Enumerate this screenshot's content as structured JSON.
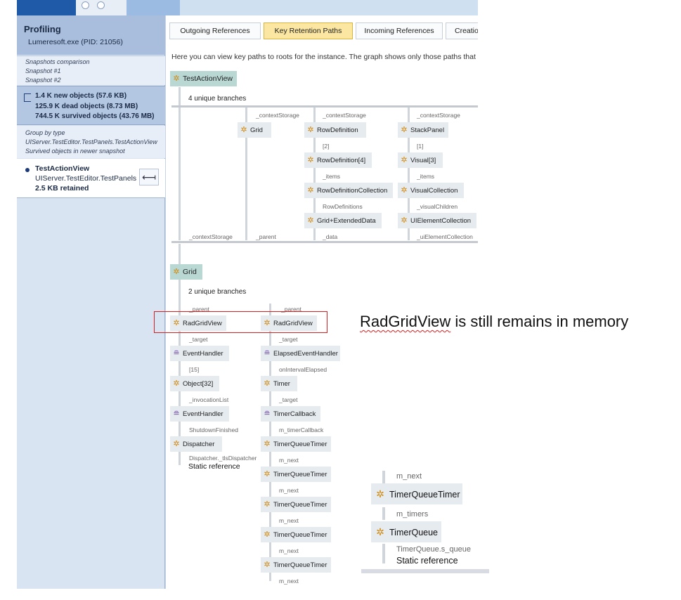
{
  "profiling": {
    "title": "Profiling",
    "process": "Lumeresoft.exe (PID: 21056)",
    "comparison": [
      "Snapshots comparison",
      "Snapshot #1",
      "Snapshot #2"
    ],
    "stats": {
      "new_objects": "1.4 K new objects (57.6 KB)",
      "dead_objects": "125.9 K dead objects (8.73 MB)",
      "survived_objects": "744.5 K survived objects (43.76 MB)"
    },
    "group": [
      "Group by type",
      "UIServer.TestEditor.TestPanels.TestActionView",
      "Survived objects in newer snapshot"
    ],
    "selected_item": {
      "name": "TestActionView",
      "namespace": "UIServer.TestEditor.TestPanels",
      "retained": "2.5 KB retained"
    }
  },
  "tabs": [
    "Outgoing References",
    "Key Retention Paths",
    "Incoming References",
    "Creatio"
  ],
  "active_tab": "Key Retention Paths",
  "description": "Here you can view key paths to roots for the instance. The graph shows only those paths that dif",
  "graph": {
    "root1": "TestActionView",
    "root1_branches": "4 unique branches",
    "b1_edges": [
      "_contextStorage",
      "_contextStorage",
      "_contextStorage"
    ],
    "grid_node": "Grid",
    "rowdef_chain": [
      "RowDefinition",
      "RowDefinition[4]",
      "RowDefinitionCollection",
      "Grid+ExtendedData"
    ],
    "rowdef_edges": [
      "[2]",
      "_items",
      "RowDefinitions",
      "_data"
    ],
    "stack_chain": [
      "StackPanel",
      "Visual[3]",
      "VisualCollection",
      "UIElementCollection"
    ],
    "stack_edges": [
      "[1]",
      "_items",
      "_visualChildren",
      "_uiElementCollection"
    ],
    "bottom_edges": [
      "_contextStorage",
      "_parent"
    ],
    "root2": "Grid",
    "root2_branches": "2 unique branches",
    "left_edges": [
      "_parent",
      "_target",
      "[15]",
      "_invocationList",
      "ShutdownFinished",
      "Dispatcher._tlsDispatcher"
    ],
    "left_nodes": [
      "RadGridView",
      "EventHandler",
      "Object[32]",
      "EventHandler",
      "Dispatcher"
    ],
    "left_static": "Static reference",
    "right_edges": [
      "_parent",
      "_target",
      "onIntervalElapsed",
      "_target",
      "m_timerCallback",
      "m_next",
      "m_next",
      "m_next",
      "m_next",
      "m_next"
    ],
    "right_nodes": [
      "RadGridView",
      "ElapsedEventHandler",
      "Timer",
      "TimerCallback",
      "TimerQueueTimer",
      "TimerQueueTimer",
      "TimerQueueTimer",
      "TimerQueueTimer",
      "TimerQueueTimer"
    ]
  },
  "annotation": {
    "word": "RadGridView",
    "rest": " is still remains in memory"
  },
  "zoom": {
    "edge1": "m_next",
    "node1": "TimerQueueTimer",
    "edge2": "m_timers",
    "node2": "TimerQueue",
    "edge3": "TimerQueue.s_queue",
    "static": "Static reference"
  },
  "colors": {
    "active_tab": "#fbe7a1",
    "root_node": "#b9d8d4",
    "highlight_box": "#d42020",
    "type_icon": "#d18b12",
    "delegate_icon": "#7048a8"
  }
}
